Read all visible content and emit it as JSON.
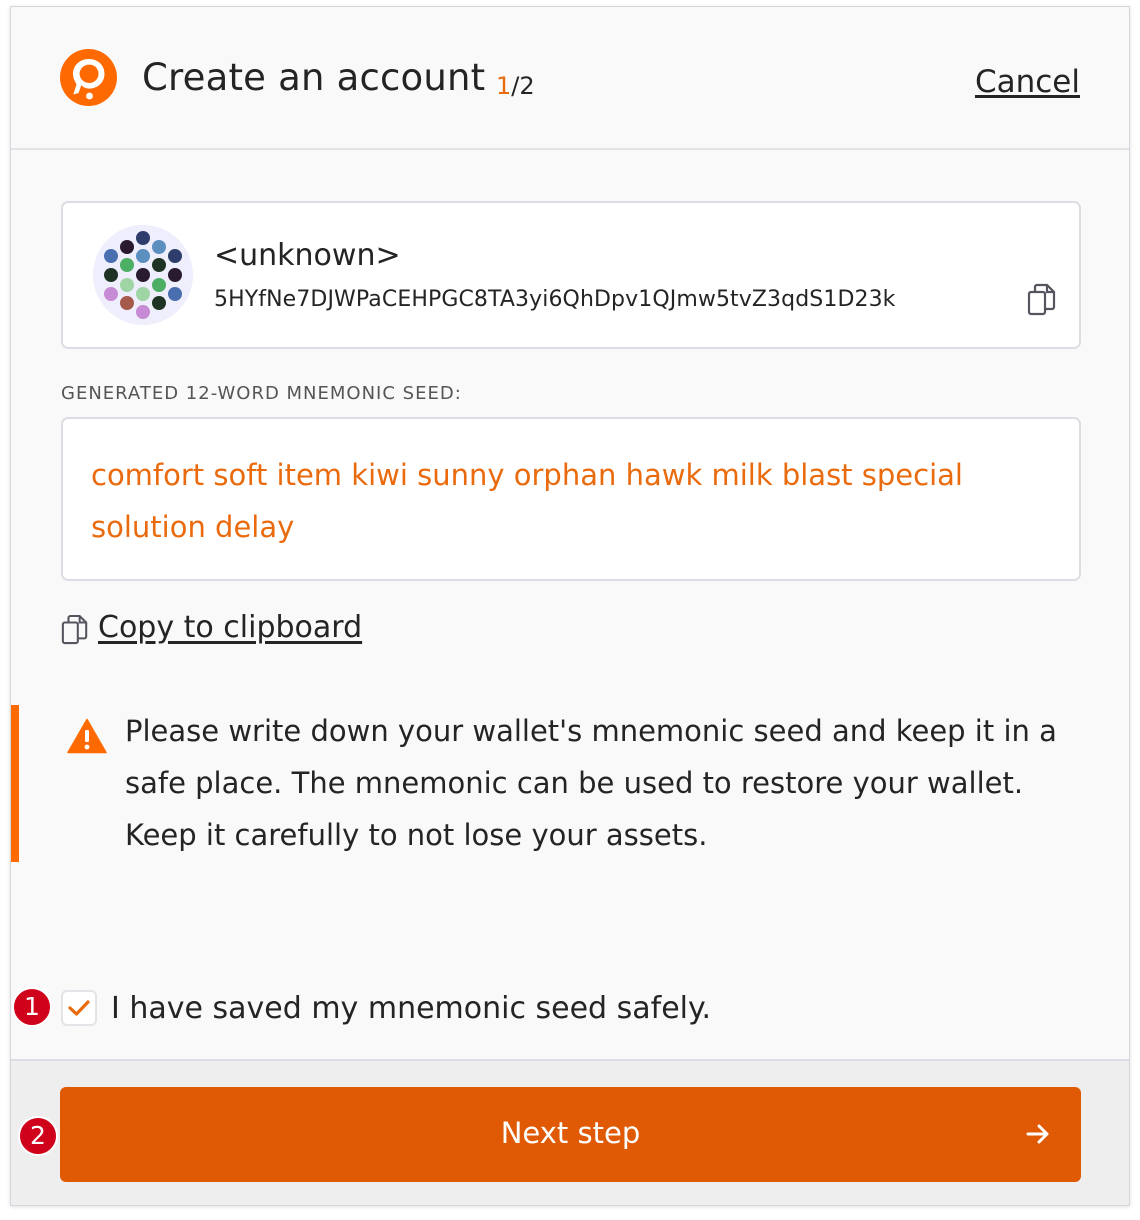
{
  "header": {
    "title": "Create an account",
    "step_current": "1",
    "step_total": "/2",
    "cancel_label": "Cancel"
  },
  "account": {
    "name": "<unknown>",
    "address": "5HYfNe7DJWPaCEHPGC8TA3yi6QhDpv1QJmw5tvZ3qdS1D23k"
  },
  "seed": {
    "label": "GENERATED 12-WORD MNEMONIC SEED:",
    "phrase": "comfort soft item kiwi sunny orphan hawk milk blast special solution delay",
    "copy_label": "Copy to clipboard"
  },
  "warning": {
    "text": "Please write down your wallet's mnemonic seed and keep it in a safe place. The mnemonic can be used to restore your wallet. Keep it carefully to not lose your assets."
  },
  "confirm": {
    "label": "I have saved my mnemonic seed safely.",
    "checked": true
  },
  "footer": {
    "next_label": "Next step"
  },
  "markers": [
    "1",
    "2"
  ],
  "colors": {
    "accent": "#e05a06",
    "seed_text": "#ea6b0e",
    "warning_bar": "#ff6a00",
    "marker": "#d0021b"
  }
}
